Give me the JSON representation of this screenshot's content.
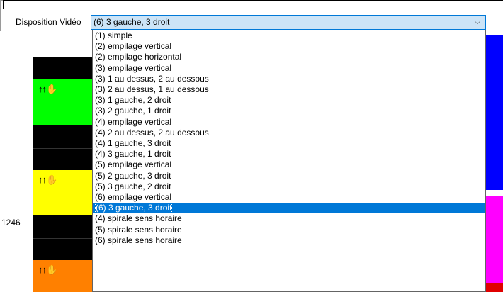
{
  "window": {
    "title": ""
  },
  "disposition": {
    "label": "Disposition Vidéo",
    "selected": "(6) 3 gauche, 3 droit"
  },
  "left_panel": {
    "number": "1246"
  },
  "options": [
    "(1) simple",
    "(2) empilage vertical",
    "(2) empilage horizontal",
    "(3) empilage vertical",
    "(3) 1 au dessus, 2 au dessous",
    "(3) 2 au dessus, 1 au dessous",
    "(3) 1 gauche, 2 droit",
    "(3) 2 gauche, 1 droit",
    "(4) empilage vertical",
    "(4) 2 au dessus, 2 au dessous",
    "(4) 1 gauche, 3 droit",
    "(4) 3 gauche, 1 droit",
    "(5) empilage vertical",
    "(5) 2 gauche, 3 droit",
    "(5) 3 gauche, 2 droit",
    "(6) empilage vertical",
    "(6) 3 gauche, 3 droit",
    "(4) spirale sens horaire",
    "(5) spirale sens horaire",
    "(6) spirale sens horaire"
  ],
  "selected_index": 16,
  "colors": {
    "accent": "#0078d7",
    "combo_bg": "#cce4f7",
    "track_green": "#00ff00",
    "track_yellow": "#ffff00",
    "track_orange": "#ff8000",
    "right_blue": "#0000ff",
    "right_magenta": "#ff00ff"
  },
  "icons": {
    "track_control": "up-arrows-hand-icon",
    "dropdown": "chevron-down-icon"
  }
}
